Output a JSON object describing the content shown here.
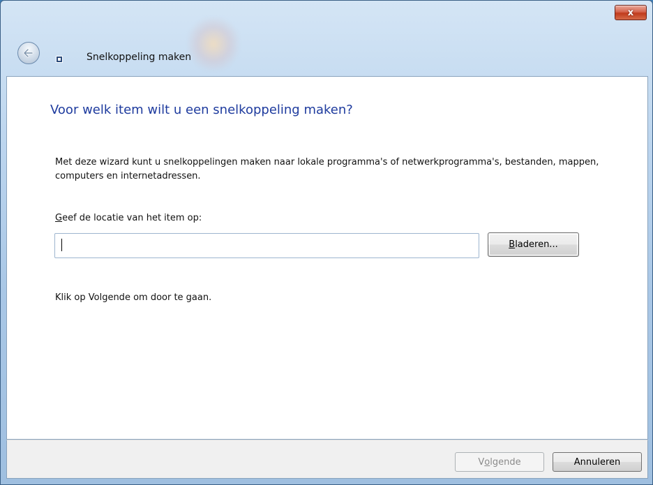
{
  "window": {
    "title": "Snelkoppeling maken",
    "close_label": "x"
  },
  "content": {
    "heading": "Voor welk item wilt u een snelkoppeling maken?",
    "description": "Met deze wizard kunt u snelkoppelingen maken naar lokale programma's of netwerkprogramma's, bestanden, mappen, computers en internetadressen.",
    "location_label_accel": "G",
    "location_label_rest": "eef de locatie van het item op:",
    "location_value": "",
    "browse_accel": "B",
    "browse_rest": "laderen...",
    "instruction": "Klik op Volgende om door te gaan."
  },
  "footer": {
    "next_pre": "V",
    "next_accel": "o",
    "next_post": "lgende",
    "cancel_label": "Annuleren"
  },
  "icons": {
    "back": "back-arrow-icon",
    "shortcut": "shortcut-icon",
    "close": "close-icon"
  },
  "colors": {
    "heading": "#1e3b9e",
    "close_button": "#c03b1d",
    "titlebar": "#bcd5ee"
  }
}
